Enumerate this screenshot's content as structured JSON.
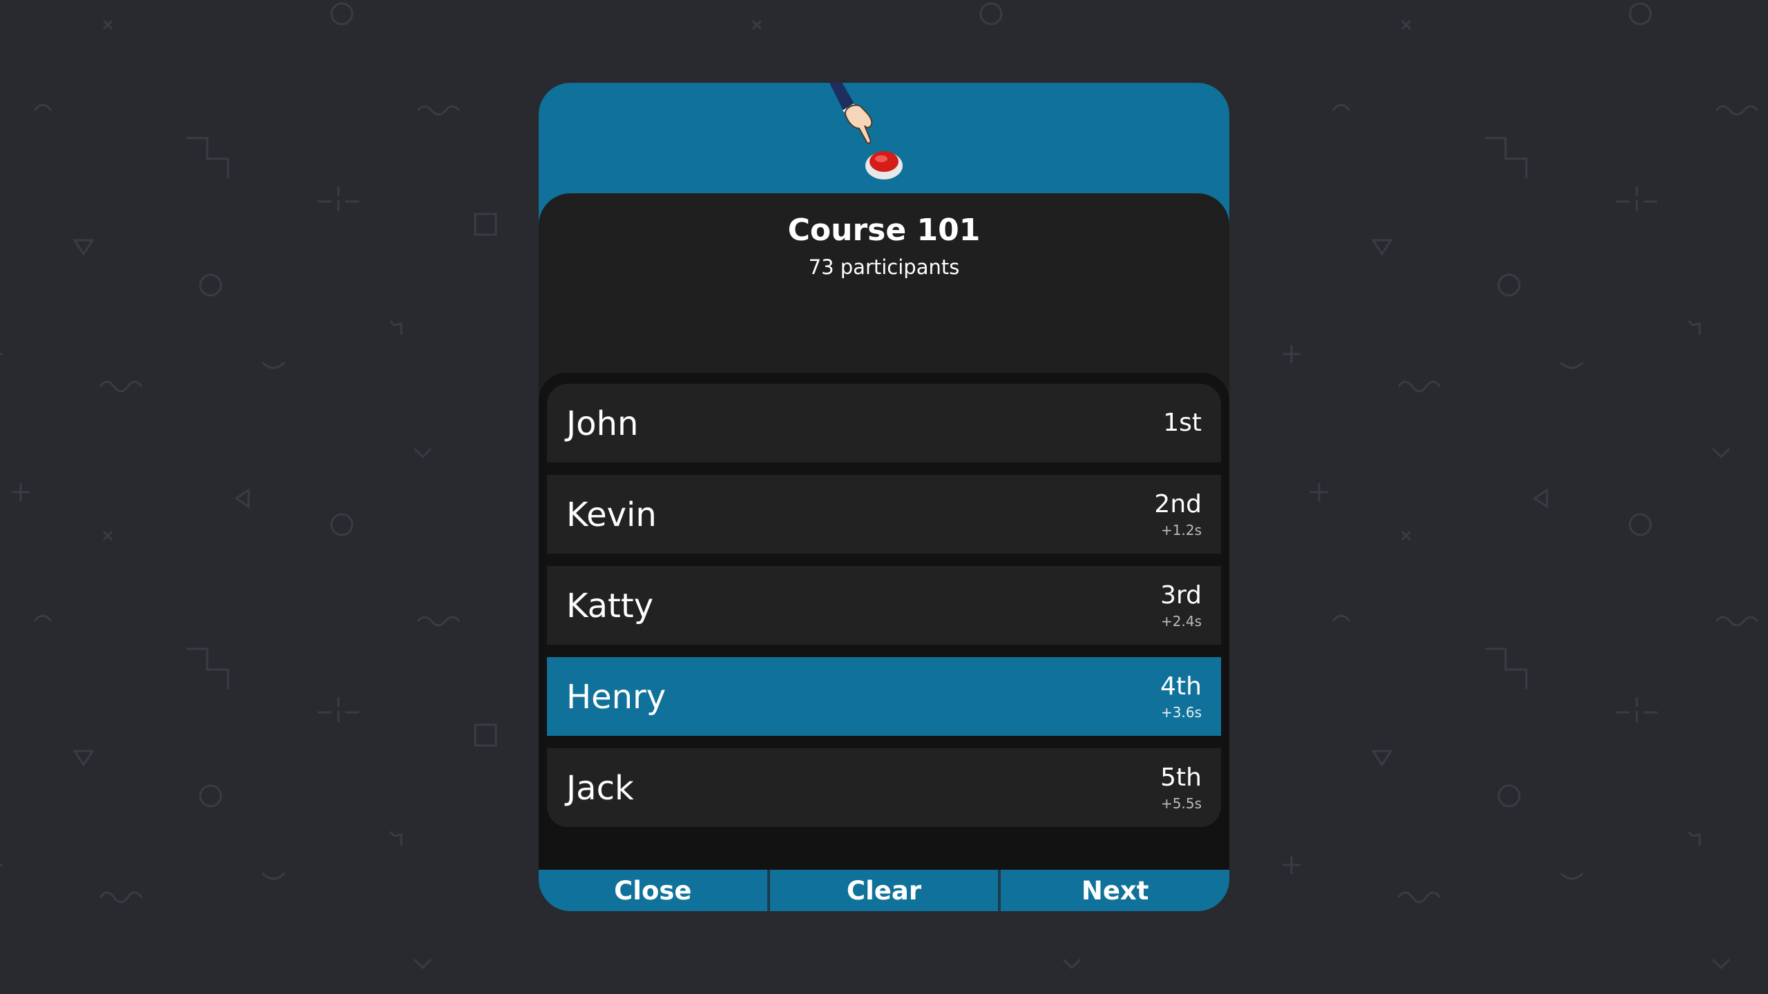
{
  "colors": {
    "background": "#282a2f",
    "accent": "#10729a",
    "panel_body": "#1f1f20",
    "list_background": "#121213",
    "row_background": "#222223",
    "buzzer_red": "#d51d18"
  },
  "header": {
    "illustration": "hand-pressing-red-buzzer",
    "course_title": "Course 101",
    "participants_label": "73 participants"
  },
  "ranking": {
    "rows": [
      {
        "name": "John",
        "place": "1st",
        "delta": "",
        "highlighted": false
      },
      {
        "name": "Kevin",
        "place": "2nd",
        "delta": "+1.2s",
        "highlighted": false
      },
      {
        "name": "Katty",
        "place": "3rd",
        "delta": "+2.4s",
        "highlighted": false
      },
      {
        "name": "Henry",
        "place": "4th",
        "delta": "+3.6s",
        "highlighted": true
      },
      {
        "name": "Jack",
        "place": "5th",
        "delta": "+5.5s",
        "highlighted": false
      }
    ]
  },
  "footer": {
    "close_label": "Close",
    "clear_label": "Clear",
    "next_label": "Next"
  }
}
